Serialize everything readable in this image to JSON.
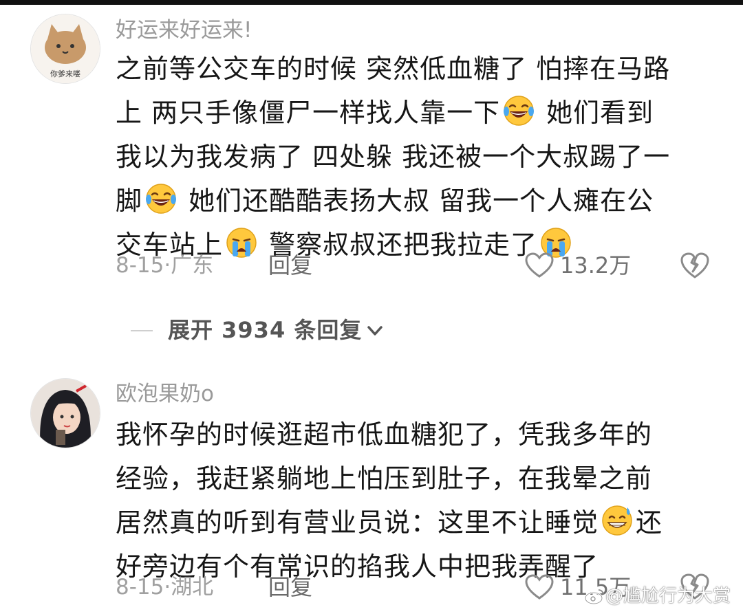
{
  "comments": [
    {
      "username": "好运来好运来!",
      "avatar_text": "你爹来喽",
      "lines": [
        [
          "之前等公交车的时候 突然低血糖了 怕摔在马路"
        ],
        [
          "上 两只手像僵尸一样找人靠一下",
          "laughing-crying-emoji",
          " 她们看到"
        ],
        [
          "我以为我发病了 四处躲 我还被一个大叔踢了一"
        ],
        [
          "脚",
          "laughing-crying-emoji",
          " 她们还酷酷表扬大叔 留我一个人瘫在公"
        ],
        [
          "交车站上",
          "crying-emoji",
          " 警察叔叔还把我拉走了",
          "crying-emoji"
        ]
      ],
      "date": "8-15",
      "location": "广东",
      "reply_label": "回复",
      "likes": "13.2万"
    },
    {
      "username": "欧泡果奶o",
      "lines": [
        [
          "我怀孕的时候逛超市低血糖犯了，凭我多年的"
        ],
        [
          "经验，我赶紧躺地上怕压到肚子，在我晕之前"
        ],
        [
          "居然真的听到有营业员说：这里不让睡觉",
          "grinning-sweat-emoji",
          "还"
        ],
        [
          "好旁边有个有常识的掐我人中把我弄醒了"
        ]
      ],
      "date": "8-15",
      "location": "湖北",
      "reply_label": "回复",
      "likes": "11.5万"
    }
  ],
  "expand_replies": {
    "label": "展开 3934 条回复"
  },
  "watermark": "@尴尬行为大赏",
  "colors": {
    "text": "#161616",
    "meta": "#a0a0a0",
    "username": "#9a9a9a",
    "emoji_face": "#ffc83d"
  }
}
